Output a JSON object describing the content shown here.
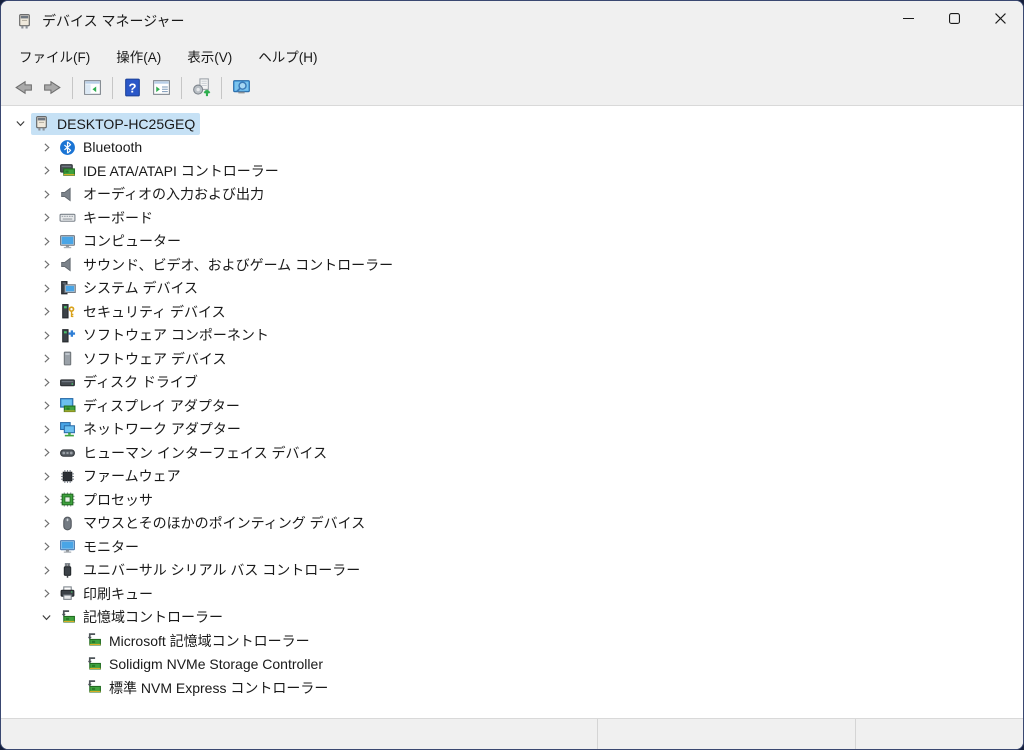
{
  "window": {
    "title": "デバイス マネージャー",
    "controls": [
      {
        "name": "minimize",
        "icon": "minimize-icon"
      },
      {
        "name": "maximize",
        "icon": "maximize-icon"
      },
      {
        "name": "close",
        "icon": "close-icon"
      }
    ]
  },
  "menu": {
    "items": [
      {
        "name": "file",
        "label": "ファイル(F)"
      },
      {
        "name": "action",
        "label": "操作(A)"
      },
      {
        "name": "view",
        "label": "表示(V)"
      },
      {
        "name": "help",
        "label": "ヘルプ(H)"
      }
    ]
  },
  "toolbar": {
    "items": [
      {
        "type": "button",
        "name": "back-button",
        "icon": "arrow-back"
      },
      {
        "type": "button",
        "name": "forward-button",
        "icon": "arrow-forward"
      },
      {
        "type": "separator"
      },
      {
        "type": "button",
        "name": "show-console-tree-button",
        "icon": "console-tree"
      },
      {
        "type": "separator"
      },
      {
        "type": "button",
        "name": "help-button",
        "icon": "help"
      },
      {
        "type": "button",
        "name": "properties-button",
        "icon": "properties"
      },
      {
        "type": "separator"
      },
      {
        "type": "button",
        "name": "scan-hardware-changes-button",
        "icon": "scan-hardware"
      },
      {
        "type": "separator"
      },
      {
        "type": "button",
        "name": "search-computer-button",
        "icon": "search-computer"
      }
    ]
  },
  "tree": {
    "items": [
      {
        "label": "DESKTOP-HC25GEQ",
        "icon": "device-manager",
        "level": 0,
        "state": "expanded",
        "selected": true
      },
      {
        "label": "Bluetooth",
        "icon": "bluetooth",
        "level": 1,
        "state": "collapsed",
        "selected": false
      },
      {
        "label": "IDE ATA/ATAPI コントローラー",
        "icon": "ide-controller",
        "level": 1,
        "state": "collapsed",
        "selected": false
      },
      {
        "label": "オーディオの入力および出力",
        "icon": "audio-endpoint",
        "level": 1,
        "state": "collapsed",
        "selected": false
      },
      {
        "label": "キーボード",
        "icon": "keyboard",
        "level": 1,
        "state": "collapsed",
        "selected": false
      },
      {
        "label": "コンピューター",
        "icon": "computer",
        "level": 1,
        "state": "collapsed",
        "selected": false
      },
      {
        "label": "サウンド、ビデオ、およびゲーム コントローラー",
        "icon": "sound-controller",
        "level": 1,
        "state": "collapsed",
        "selected": false
      },
      {
        "label": "システム デバイス",
        "icon": "system-device",
        "level": 1,
        "state": "collapsed",
        "selected": false
      },
      {
        "label": "セキュリティ デバイス",
        "icon": "security-device",
        "level": 1,
        "state": "collapsed",
        "selected": false
      },
      {
        "label": "ソフトウェア コンポーネント",
        "icon": "software-component",
        "level": 1,
        "state": "collapsed",
        "selected": false
      },
      {
        "label": "ソフトウェア デバイス",
        "icon": "software-device",
        "level": 1,
        "state": "collapsed",
        "selected": false
      },
      {
        "label": "ディスク ドライブ",
        "icon": "disk-drive",
        "level": 1,
        "state": "collapsed",
        "selected": false
      },
      {
        "label": "ディスプレイ アダプター",
        "icon": "display-adapter",
        "level": 1,
        "state": "collapsed",
        "selected": false
      },
      {
        "label": "ネットワーク アダプター",
        "icon": "network-adapter",
        "level": 1,
        "state": "collapsed",
        "selected": false
      },
      {
        "label": "ヒューマン インターフェイス デバイス",
        "icon": "hid",
        "level": 1,
        "state": "collapsed",
        "selected": false
      },
      {
        "label": "ファームウェア",
        "icon": "firmware",
        "level": 1,
        "state": "collapsed",
        "selected": false
      },
      {
        "label": "プロセッサ",
        "icon": "processor",
        "level": 1,
        "state": "collapsed",
        "selected": false
      },
      {
        "label": "マウスとそのほかのポインティング デバイス",
        "icon": "mouse",
        "level": 1,
        "state": "collapsed",
        "selected": false
      },
      {
        "label": "モニター",
        "icon": "monitor",
        "level": 1,
        "state": "collapsed",
        "selected": false
      },
      {
        "label": "ユニバーサル シリアル バス コントローラー",
        "icon": "usb-controller",
        "level": 1,
        "state": "collapsed",
        "selected": false
      },
      {
        "label": "印刷キュー",
        "icon": "print-queue",
        "level": 1,
        "state": "collapsed",
        "selected": false
      },
      {
        "label": "記憶域コントローラー",
        "icon": "storage-controller",
        "level": 1,
        "state": "expanded",
        "selected": false
      },
      {
        "label": "Microsoft 記憶域コントローラー",
        "icon": "storage-controller",
        "level": 2,
        "state": null,
        "selected": false
      },
      {
        "label": "Solidigm NVMe Storage Controller",
        "icon": "storage-controller",
        "level": 2,
        "state": null,
        "selected": false
      },
      {
        "label": "標準 NVM Express コントローラー",
        "icon": "storage-controller",
        "level": 2,
        "state": null,
        "selected": false
      }
    ]
  },
  "statusbar": {
    "panes": [
      "",
      "",
      ""
    ]
  },
  "colors": {
    "selection": "#c6e1f5",
    "window_bg": "#f0f0f0",
    "content_bg": "#ffffff",
    "outside_bg": "#16203c",
    "border": "#3a4871"
  }
}
